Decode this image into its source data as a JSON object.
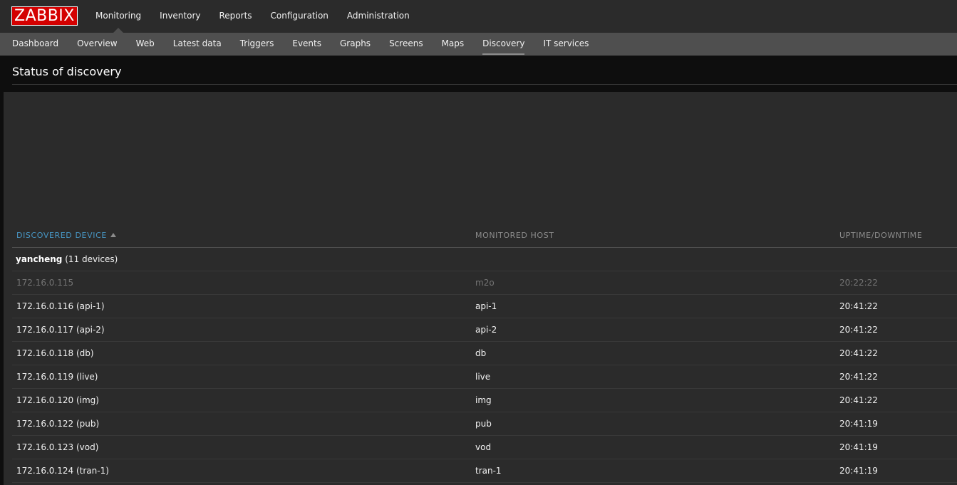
{
  "logo": "ZABBIX",
  "main_menu": [
    "Monitoring",
    "Inventory",
    "Reports",
    "Configuration",
    "Administration"
  ],
  "main_menu_selected": "Monitoring",
  "sub_menu": [
    "Dashboard",
    "Overview",
    "Web",
    "Latest data",
    "Triggers",
    "Events",
    "Graphs",
    "Screens",
    "Maps",
    "Discovery",
    "IT services"
  ],
  "sub_menu_selected": "Discovery",
  "page_title": "Status of discovery",
  "table": {
    "columns": {
      "device": "DISCOVERED DEVICE",
      "host": "MONITORED HOST",
      "uptime": "UPTIME/DOWNTIME"
    },
    "sort_icon": "sort-ascending-arrow",
    "group": {
      "name": "yancheng",
      "count": "(11 devices)"
    },
    "rows": [
      {
        "device": "172.16.0.115",
        "host": "m2o",
        "uptime": "20:22:22",
        "status": "disabled"
      },
      {
        "device": "172.16.0.116 (api-1)",
        "host": "api-1",
        "uptime": "20:41:22",
        "status": "up"
      },
      {
        "device": "172.16.0.117 (api-2)",
        "host": "api-2",
        "uptime": "20:41:22",
        "status": "up"
      },
      {
        "device": "172.16.0.118 (db)",
        "host": "db",
        "uptime": "20:41:22",
        "status": "up"
      },
      {
        "device": "172.16.0.119 (live)",
        "host": "live",
        "uptime": "20:41:22",
        "status": "up"
      },
      {
        "device": "172.16.0.120 (img)",
        "host": "img",
        "uptime": "20:41:22",
        "status": "up"
      },
      {
        "device": "172.16.0.122 (pub)",
        "host": "pub",
        "uptime": "20:41:19",
        "status": "up"
      },
      {
        "device": "172.16.0.123 (vod)",
        "host": "vod",
        "uptime": "20:41:19",
        "status": "up"
      },
      {
        "device": "172.16.0.124 (tran-1)",
        "host": "tran-1",
        "uptime": "20:41:19",
        "status": "up"
      }
    ]
  },
  "colors": {
    "brand": "#d40000",
    "sorted_header": "#4796c4",
    "submenu_bg": "#4f4f4f",
    "page_bg": "#2b2b2b",
    "header_bg": "#0e0e0e"
  }
}
